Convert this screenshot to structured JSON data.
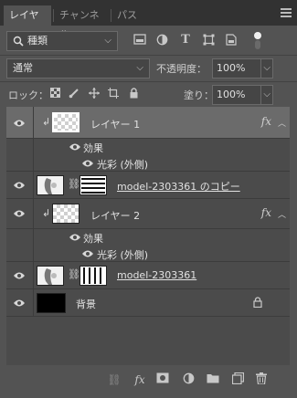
{
  "tabs": [
    {
      "label": "レイヤー",
      "active": true
    },
    {
      "label": "チャンネル",
      "active": false
    },
    {
      "label": "パス",
      "active": false
    }
  ],
  "tab_close": "×",
  "filter": {
    "kind_label": "種類"
  },
  "blend_mode": "通常",
  "opacity": {
    "label": "不透明度：",
    "value": "100%"
  },
  "lock": {
    "label": "ロック："
  },
  "fill": {
    "label": "塗り：",
    "value": "100%"
  },
  "layers": [
    {
      "name": "レイヤー 1",
      "selected": true,
      "clipped": true,
      "has_fx": true,
      "fx": "fx"
    },
    {
      "effect_header": "効果"
    },
    {
      "effect_name": "光彩 (外側)"
    },
    {
      "name": "model-2303361 のコピー",
      "selected": false
    },
    {
      "name": "レイヤー 2",
      "selected": false,
      "clipped": true,
      "has_fx": true,
      "fx": "fx"
    },
    {
      "effect_header": "効果"
    },
    {
      "effect_name": "光彩 (外側)"
    },
    {
      "name": "model-2303361",
      "selected": false
    },
    {
      "name": "背景",
      "selected": false,
      "locked": true
    }
  ],
  "colors": {
    "panel": "#535353",
    "tabbar": "#323232",
    "selected": "#6b6b6b"
  }
}
